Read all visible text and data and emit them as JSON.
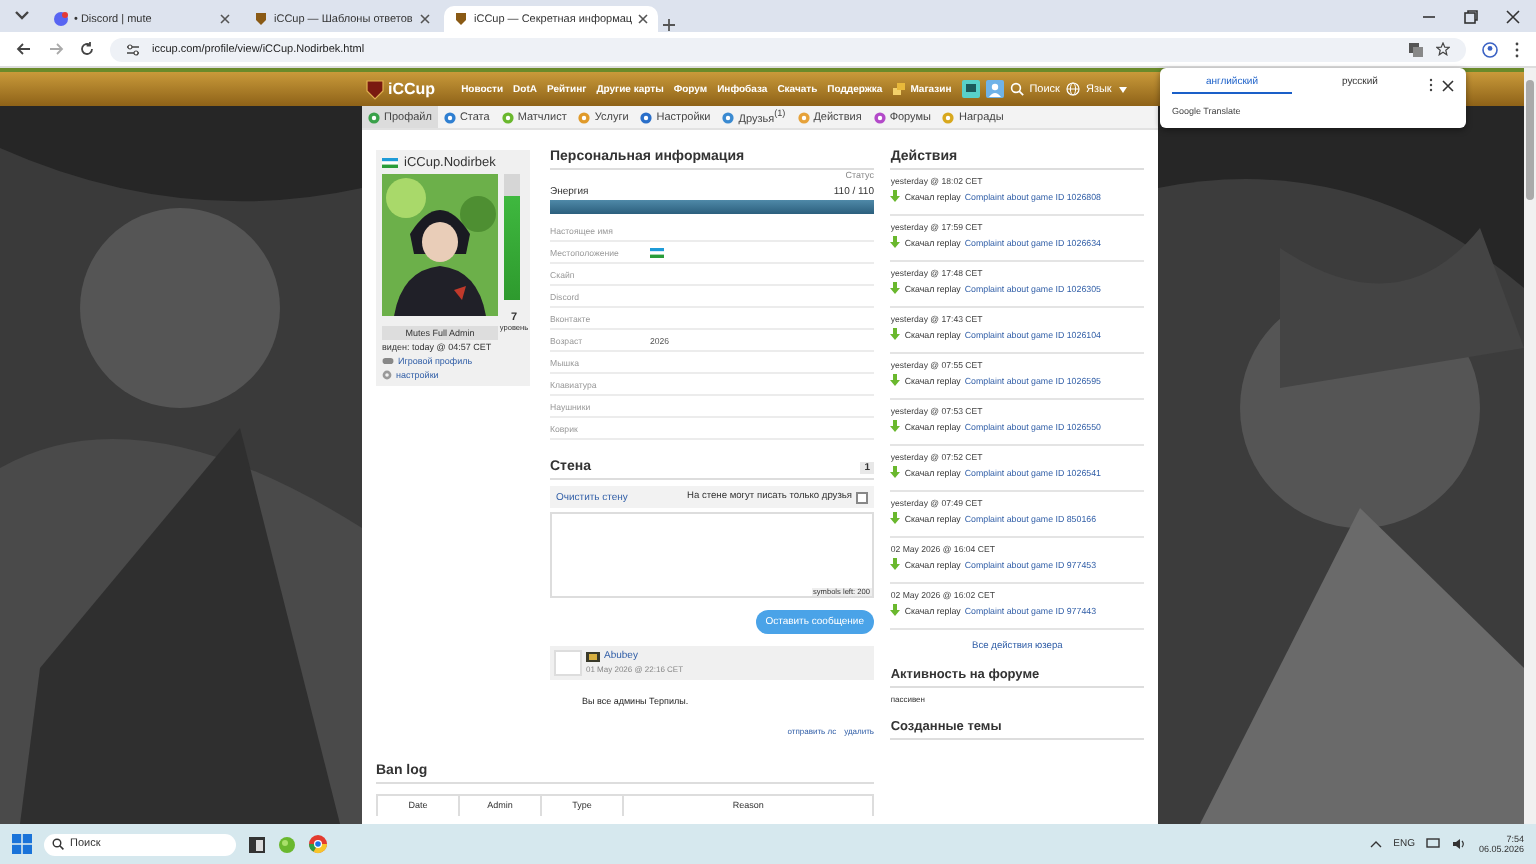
{
  "browser": {
    "tabs": [
      {
        "title": "• Discord | mute",
        "kind": "discord",
        "selected": false
      },
      {
        "title": "iCCup — Шаблоны ответов",
        "kind": "site",
        "selected": false
      },
      {
        "title": "iCCup — Секретная информац",
        "kind": "site",
        "selected": true
      }
    ],
    "url": "iccup.com/profile/view/iCCup.Nodirbek.html"
  },
  "translate": {
    "tabs": [
      {
        "label": "английский",
        "selected": true
      },
      {
        "label": "русский",
        "selected": false
      }
    ],
    "footer": "Google Translate"
  },
  "site": {
    "logo": "iCCup",
    "nav": [
      "Новости",
      "DotA",
      "Рейтинг",
      "Другие карты",
      "Форум",
      "Инфобаза",
      "Скачать",
      "Поддержка"
    ],
    "shop": "Магазин",
    "search": "Поиск",
    "language": "Язык"
  },
  "subnav": [
    {
      "label": "Профайл",
      "selected": true
    },
    {
      "label": "Стата",
      "selected": false
    },
    {
      "label": "Матчлист",
      "selected": false
    },
    {
      "label": "Услуги",
      "selected": false
    },
    {
      "label": "Настройки",
      "selected": false
    },
    {
      "label": "Друзья$^{(1)}$",
      "selected": false
    },
    {
      "label": "Действия",
      "selected": false
    },
    {
      "label": "Форумы",
      "selected": false
    },
    {
      "label": "Награды",
      "selected": false
    }
  ],
  "profile": {
    "name": "iCCup.Nodirbek",
    "level": 0.82,
    "level_number": "7",
    "level_label": "уровень",
    "role": "Mutes Full Admin",
    "seen": "виден: today @ 04:57 CET",
    "links": [
      {
        "label": "Игровой профиль",
        "kind": "game"
      },
      {
        "label": "настройки",
        "kind": "settings"
      }
    ]
  },
  "personal": {
    "title": "Персональная информация",
    "status_label": "Статус",
    "energy_label": "Энергия",
    "energy_value": "110 / 110",
    "level": 1.0,
    "fields": [
      {
        "label": "Настоящее имя",
        "kind": "text"
      },
      {
        "label": "Местоположение",
        "kind": "flag"
      },
      {
        "label": "Скайп",
        "kind": "text"
      },
      {
        "label": "Discord",
        "kind": "text"
      },
      {
        "label": "Вконтакте",
        "kind": "text"
      },
      {
        "label": "Возраст",
        "kind": "text",
        "value": "2026"
      },
      {
        "label": "Мышка",
        "kind": "text"
      },
      {
        "label": "Клавиатура",
        "kind": "text"
      },
      {
        "label": "Наушники",
        "kind": "text"
      },
      {
        "label": "Коврик",
        "kind": "text"
      }
    ]
  },
  "wall": {
    "title": "Стена",
    "page": "1",
    "clear": "Очистить стену",
    "friends_only": "На стене могут писать только друзья",
    "friends_only_checked": false,
    "symbols": "symbols left: 200",
    "button": "Оставить сообщение",
    "comments": [
      {
        "author": "Abubey",
        "time": "01 May 2026 @ 22:16 CET",
        "text": "Вы все админы Терпилы.",
        "actions": [
          "отправить лс",
          "удалить"
        ]
      }
    ]
  },
  "ban_log": {
    "title": "Ban log",
    "columns": [
      "Date",
      "Admin",
      "Type",
      "Reason"
    ]
  },
  "actions": {
    "title": "Действия",
    "items": [
      {
        "time": "yesterday @ 18:02 CET",
        "verb": "Скачал replay",
        "link": "Complaint about game ID 1026808"
      },
      {
        "time": "yesterday @ 17:59 CET",
        "verb": "Скачал replay",
        "link": "Complaint about game ID 1026634"
      },
      {
        "time": "yesterday @ 17:48 CET",
        "verb": "Скачал replay",
        "link": "Complaint about game ID 1026305"
      },
      {
        "time": "yesterday @ 17:43 CET",
        "verb": "Скачал replay",
        "link": "Complaint about game ID 1026104"
      },
      {
        "time": "yesterday @ 07:55 CET",
        "verb": "Скачал replay",
        "link": "Complaint about game ID 1026595"
      },
      {
        "time": "yesterday @ 07:53 CET",
        "verb": "Скачал replay",
        "link": "Complaint about game ID 1026550"
      },
      {
        "time": "yesterday @ 07:52 CET",
        "verb": "Скачал replay",
        "link": "Complaint about game ID 1026541"
      },
      {
        "time": "yesterday @ 07:49 CET",
        "verb": "Скачал replay",
        "link": "Complaint about game ID 850166"
      },
      {
        "time": "02 May 2026 @ 16:04 CET",
        "verb": "Скачал replay",
        "link": "Complaint about game ID 977453"
      },
      {
        "time": "02 May 2026 @ 16:02 CET",
        "verb": "Скачал replay",
        "link": "Complaint about game ID 977443"
      }
    ],
    "all_link": "Все действия юзера"
  },
  "forum": {
    "title": "Активность на форуме",
    "value": "пассивен"
  },
  "topics": {
    "title": "Созданные темы"
  },
  "taskbar": {
    "search": "Поиск",
    "language": "ENG",
    "time": "7:54",
    "date": "06.05.2026"
  }
}
